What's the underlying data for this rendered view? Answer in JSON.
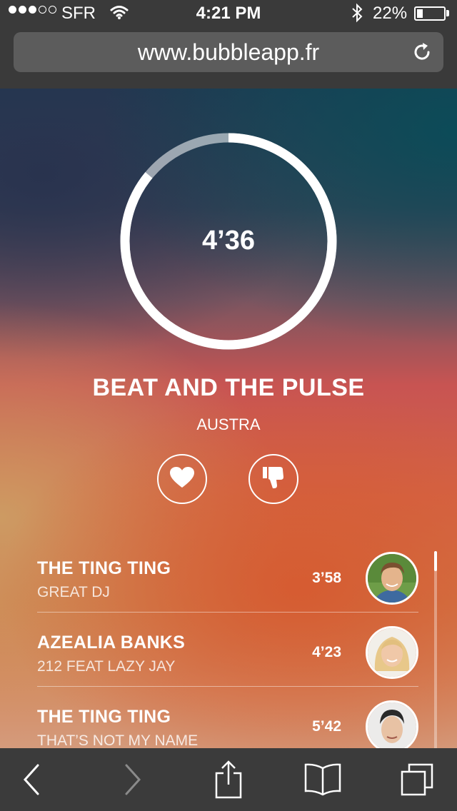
{
  "status_bar": {
    "carrier": "SFR",
    "time": "4:21 PM",
    "battery": "22%",
    "battery_level": 0.22,
    "signal_bars_filled": 3,
    "signal_bars_total": 5
  },
  "browser": {
    "url": "www.bubbleapp.fr"
  },
  "player": {
    "time_remaining": "4’36",
    "progress": 0.14,
    "title": "BEAT AND THE PULSE",
    "artist": "AUSTRA"
  },
  "queue": [
    {
      "artist": "THE TING TING",
      "track": "GREAT DJ",
      "duration": "3’58",
      "avatar": "male-avatar-1"
    },
    {
      "artist": "AZEALIA BANKS",
      "track": "212 FEAT LAZY JAY",
      "duration": "4’23",
      "avatar": "female-avatar"
    },
    {
      "artist": "THE TING TING",
      "track": "THAT’S NOT MY NAME",
      "duration": "5’42",
      "avatar": "male-avatar-2"
    }
  ],
  "icons": {
    "like": "heart-icon",
    "dislike": "thumbs-down-icon",
    "back": "chevron-left-icon",
    "forward": "chevron-right-icon",
    "share": "share-icon",
    "bookmarks": "book-icon",
    "tabs": "tabs-icon",
    "reload": "reload-icon"
  },
  "colors": {
    "bar_bg": "#3a3a3a",
    "url_field": "#5c5c5c",
    "accent_orange": "#d46446"
  }
}
